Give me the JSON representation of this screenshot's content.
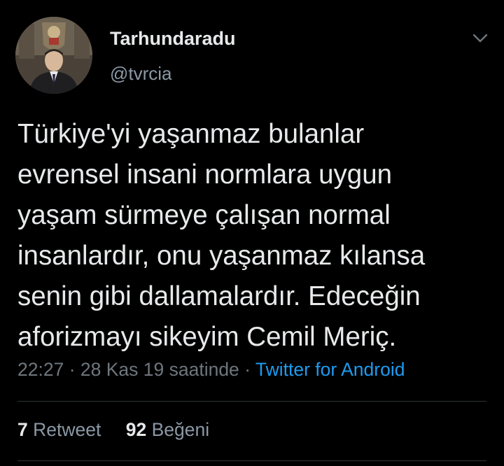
{
  "author": {
    "display_name": "Tarhundaradu",
    "handle": "@tvrcia",
    "avatar_icon": "portrait-avatar"
  },
  "tweet": {
    "text": "Türkiye'yi yaşanmaz bulanlar\nevrensel insani normlara uygun\nyaşam sürmeye çalışan normal\ninsanlardır, onu yaşanmaz kılansa\nsenin gibi dallamalardır. Edeceğin\naforizmayı sikeyim Cemil Meriç.",
    "time": "22:27",
    "separator": "·",
    "date": "28 Kas 19 saatinde",
    "source": "Twitter for Android"
  },
  "stats": {
    "retweets_count": "7",
    "retweets_label": "Retweet",
    "likes_count": "92",
    "likes_label": "Beğeni"
  },
  "menu": {
    "icon": "chevron-down-icon"
  },
  "colors": {
    "background": "#000000",
    "text": "#e7e9ea",
    "secondary": "#8b98a5",
    "link": "#1d9bf0",
    "divider": "#2f3336"
  }
}
